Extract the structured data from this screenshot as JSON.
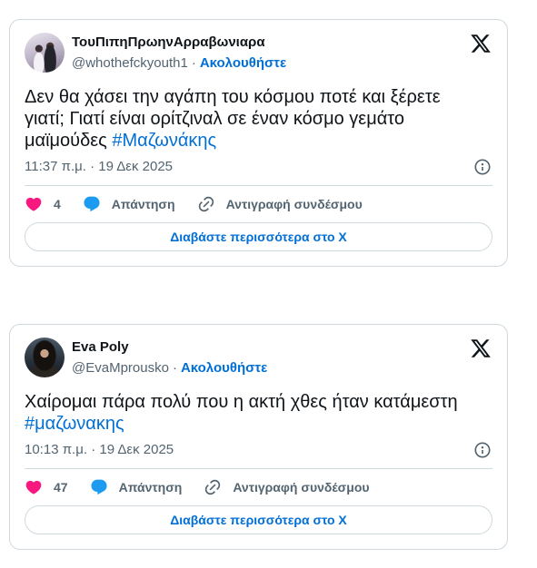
{
  "colors": {
    "text": "#0f1419",
    "secondary": "#536471",
    "link": "#006fd6",
    "border": "#cfd9de",
    "like": "#f91880",
    "reply": "#1d9bf0"
  },
  "icons": {
    "brand": "x-logo-icon",
    "info": "info-icon",
    "like": "heart-icon",
    "reply": "reply-bubble-icon",
    "copy_link": "link-icon"
  },
  "tweets": [
    {
      "author": {
        "name": "ΤουΠιπηΠρωηνΑρραβωνιαρα",
        "handle": "@whothefckyouth1",
        "separator": "·",
        "follow_label": "Ακολουθήστε"
      },
      "text": "Δεν θα χάσει την αγάπη του κόσμου ποτέ και ξέρετε γιατί; Γιατί είναι ορίτζιναλ σε έναν κόσμο γεμάτο μαϊμούδες",
      "hashtag": "#Μαζωνάκης",
      "timestamp": "11:37 π.μ. · 19 Δεκ 2025",
      "actions": {
        "likes": "4",
        "reply_label": "Απάντηση",
        "copy_link_label": "Αντιγραφή συνδέσμου"
      },
      "read_more_label": "Διαβάστε περισσότερα στο X"
    },
    {
      "author": {
        "name": "Eva Poly",
        "handle": "@EvaMprousko",
        "separator": "·",
        "follow_label": "Ακολουθήστε"
      },
      "text": "Χαίρομαι πάρα πολύ που η ακτή χθες ήταν κατάμεστη",
      "hashtag": "#μαζωνακης",
      "timestamp": "10:13 π.μ. · 19 Δεκ 2025",
      "actions": {
        "likes": "47",
        "reply_label": "Απάντηση",
        "copy_link_label": "Αντιγραφή συνδέσμου"
      },
      "read_more_label": "Διαβάστε περισσότερα στο X"
    }
  ]
}
